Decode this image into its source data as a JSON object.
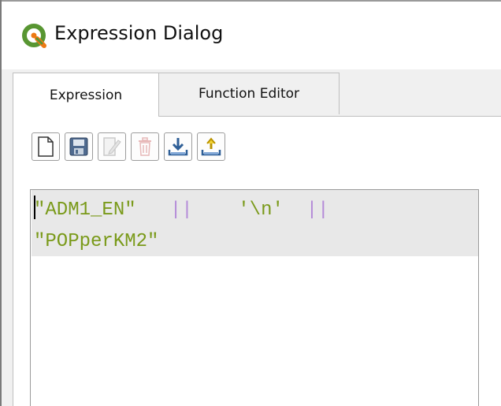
{
  "window": {
    "title": "Expression Dialog",
    "icon": "qgis-logo-icon"
  },
  "tabs": [
    {
      "label": "Expression",
      "active": true
    },
    {
      "label": "Function Editor",
      "active": false
    }
  ],
  "toolbar": {
    "buttons": [
      {
        "name": "new-file-icon",
        "enabled": true
      },
      {
        "name": "save-icon",
        "enabled": true
      },
      {
        "name": "edit-icon",
        "enabled": false
      },
      {
        "name": "delete-icon",
        "enabled": false
      },
      {
        "name": "import-icon",
        "enabled": true
      },
      {
        "name": "export-icon",
        "enabled": true
      }
    ]
  },
  "editor": {
    "line1": {
      "field1": "\"ADM1_EN\"",
      "op1": "||",
      "literal": "'\\n'",
      "op2": "||"
    },
    "line2": {
      "field2": "\"POPperKM2\""
    }
  },
  "colors": {
    "string": "#7a9a1a",
    "operator": "#b48ad8",
    "line_highlight": "#e8e8e8",
    "accent_green": "#589632"
  }
}
